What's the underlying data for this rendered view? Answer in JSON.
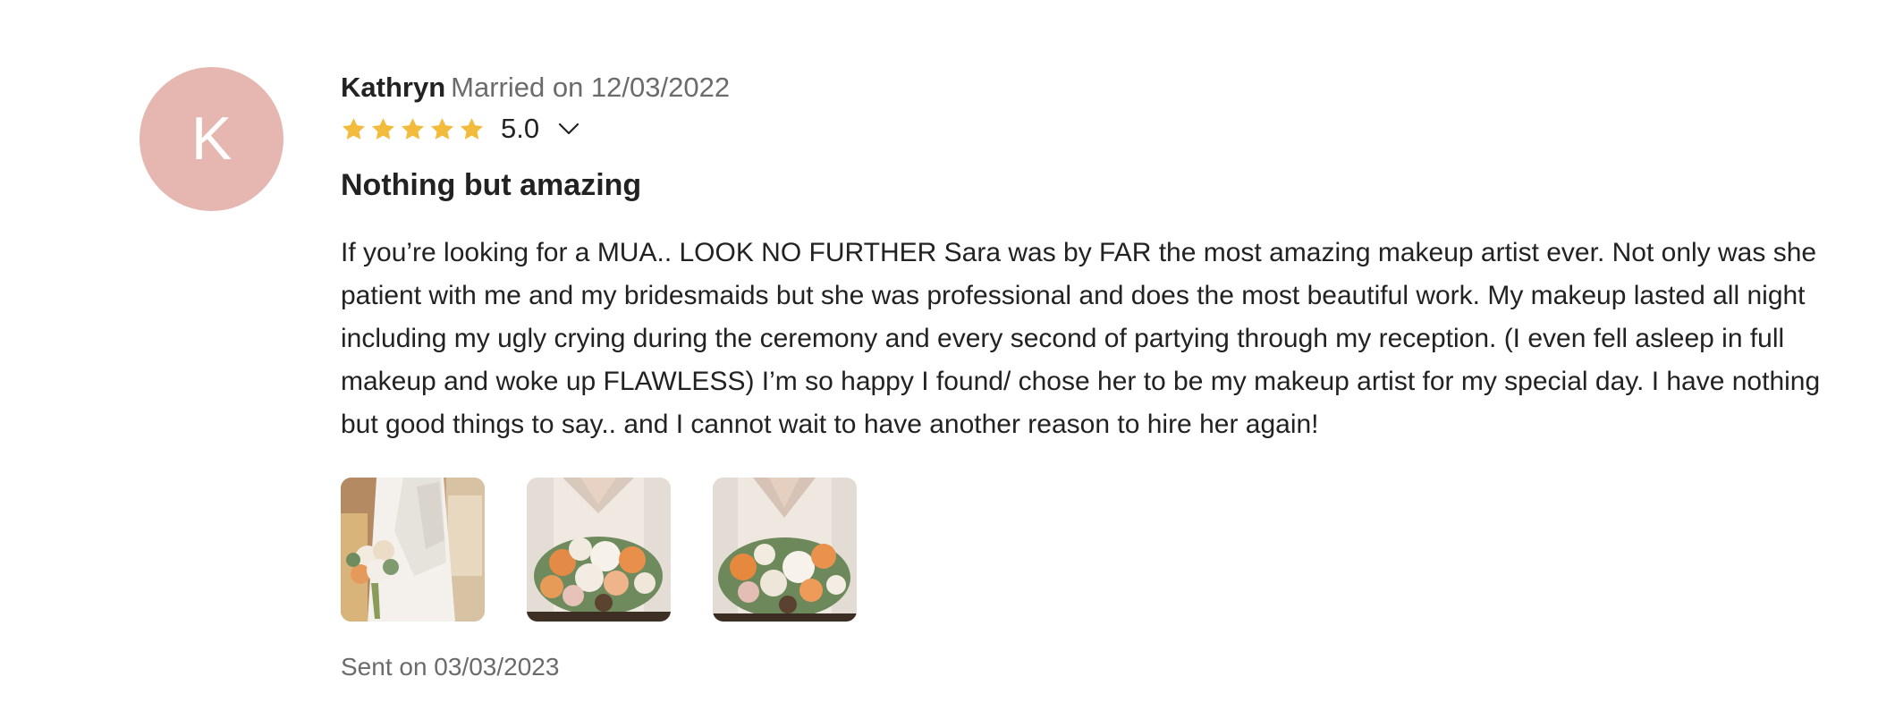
{
  "review": {
    "avatar_initial": "K",
    "author": "Kathryn",
    "married": "Married on 12/03/2022",
    "rating": {
      "value": 5.0,
      "label": "5.0",
      "max": 5
    },
    "title": "Nothing but amazing",
    "body": "If you’re looking for a MUA.. LOOK NO FURTHER Sara was by FAR the most amazing makeup artist ever. Not only was she patient with me and my bridesmaids but she was professional and does the most beautiful work. My makeup lasted all night including my ugly crying during the ceremony and every second of partying through my reception. (I even fell asleep in full makeup and woke up FLAWLESS) I’m so happy I found/ chose her to be my makeup artist for my special day. I have nothing but good things to say.. and I cannot wait to have another reason to hire her again!",
    "sent": "Sent on 03/03/2023",
    "photo_count": 3
  },
  "colors": {
    "avatar_bg": "#e5b7b0",
    "star": "#f2bb3b",
    "muted_text": "#6b6b6b",
    "text": "#222222"
  },
  "icons": {
    "rating_toggle": "chevron-down-icon",
    "star": "star-icon"
  }
}
